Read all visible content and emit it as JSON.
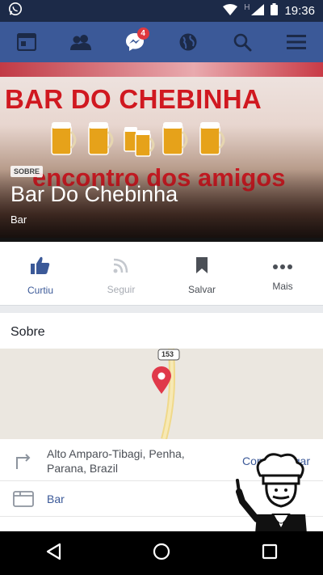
{
  "status_bar": {
    "time": "19:36",
    "network_letter": "H",
    "icons": [
      "whatsapp-icon",
      "wifi-icon",
      "signal-icon",
      "battery-icon"
    ]
  },
  "navbar": {
    "items": [
      "news-feed-icon",
      "friends-icon",
      "messenger-icon",
      "globe-icon",
      "search-icon",
      "menu-icon"
    ],
    "messenger_badge": "4",
    "color": "#3b5998"
  },
  "cover": {
    "title_text": "BAR DO CHEBINHA",
    "slogan_text": "encontro dos amigos",
    "badge": "SOBRE",
    "page_name": "Bar Do Chebinha",
    "category": "Bar"
  },
  "actions": [
    {
      "label": "Curtiu",
      "icon": "thumbs-up-icon",
      "state": "active"
    },
    {
      "label": "Seguir",
      "icon": "rss-icon",
      "state": "disabled"
    },
    {
      "label": "Salvar",
      "icon": "bookmark-icon",
      "state": "normal"
    },
    {
      "label": "Mais",
      "icon": "more-icon",
      "state": "normal"
    }
  ],
  "about": {
    "title": "Sobre",
    "map_route": "153",
    "address": "Alto Amparo-Tibagi, Penha, Parana, Brazil",
    "directions_label": "Como chegar",
    "category": "Bar"
  },
  "system_nav": [
    "back-icon",
    "home-icon",
    "recents-icon"
  ]
}
